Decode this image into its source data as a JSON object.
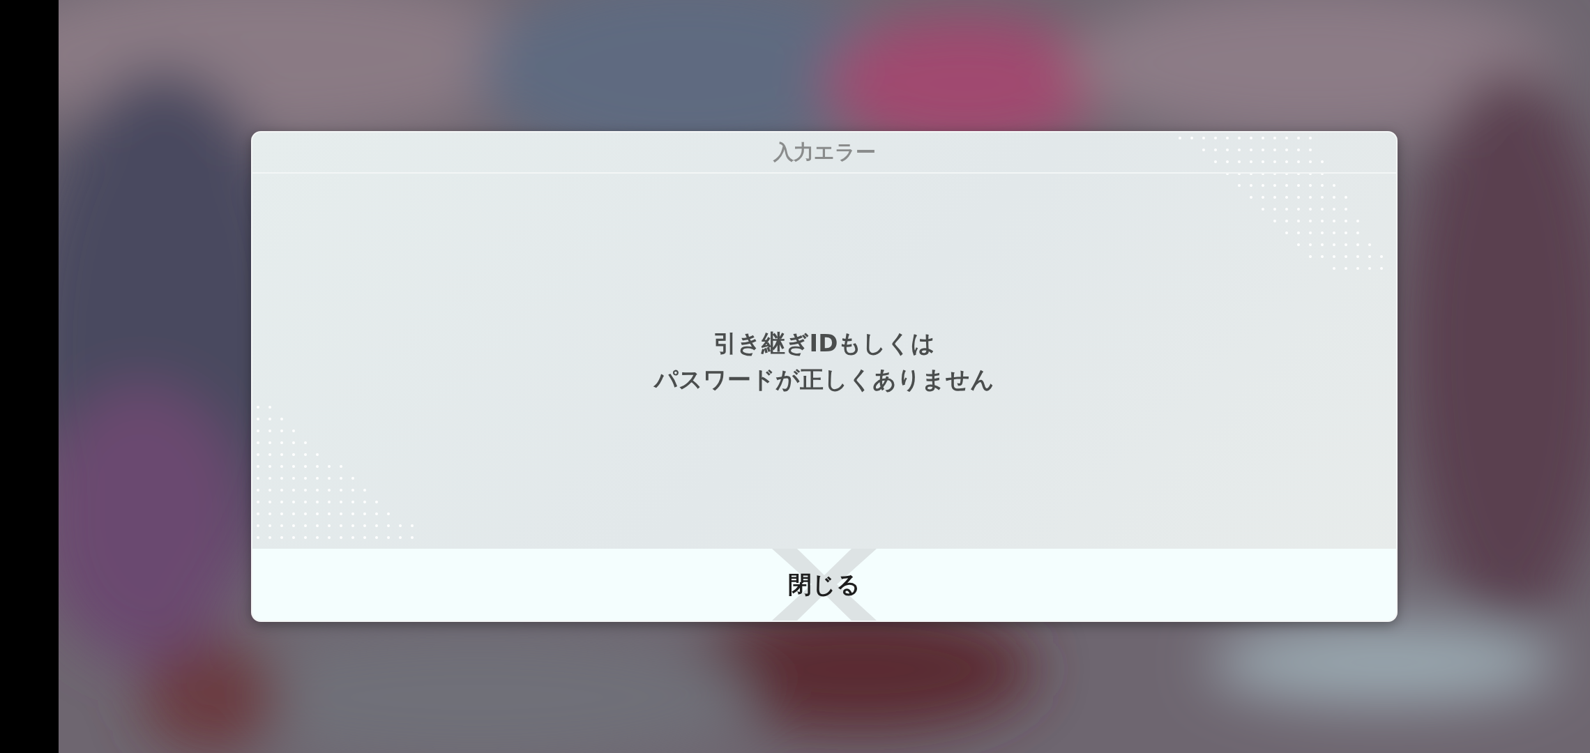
{
  "dialog": {
    "title": "入力エラー",
    "message_lines": [
      "引き継ぎIDもしくは",
      "パスワードが正しくありません"
    ],
    "close_button": {
      "label": "閉じる"
    }
  }
}
